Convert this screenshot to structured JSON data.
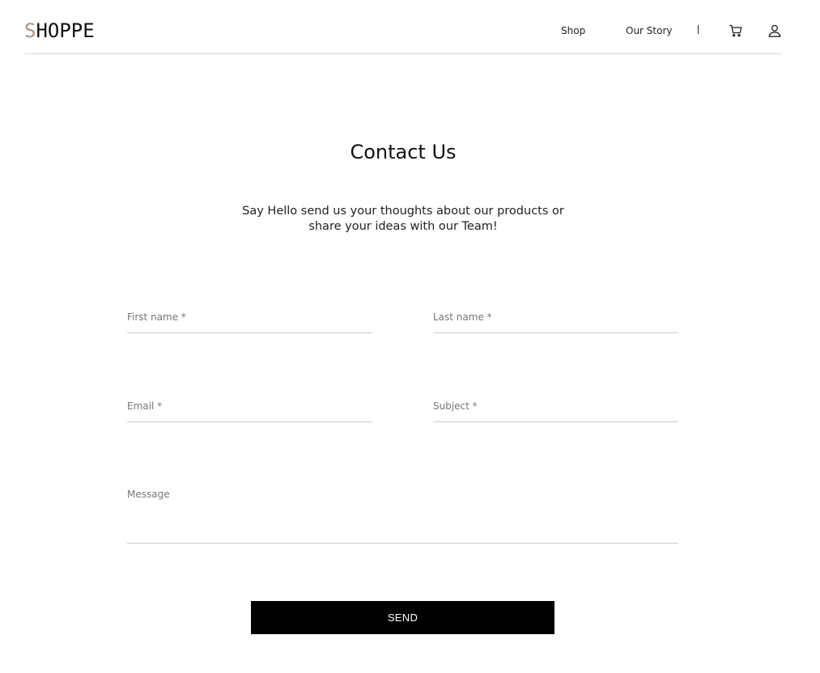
{
  "header": {
    "logo_first_letter": "S",
    "logo_rest": "HOPPE",
    "nav": {
      "shop": "Shop",
      "our_story": "Our Story",
      "divider": "|"
    },
    "icons": {
      "cart": "cart-icon",
      "user": "user-icon"
    }
  },
  "main": {
    "title": "Contact Us",
    "subtitle": "Say Hello send us your thoughts about our products or share your ideas with our Team!",
    "form": {
      "first_name_label": "First name *",
      "first_name_value": "",
      "last_name_label": "Last name *",
      "last_name_value": "",
      "email_label": "Email *",
      "email_value": "",
      "subject_label": "Subject *",
      "subject_value": "",
      "message_label": "Message",
      "message_value": "",
      "send_label": "SEND"
    }
  },
  "colors": {
    "logo_accent": "#a89680",
    "button_bg": "#000000",
    "button_text": "#ffffff",
    "field_line": "#c9c9c9",
    "label": "#777777"
  }
}
